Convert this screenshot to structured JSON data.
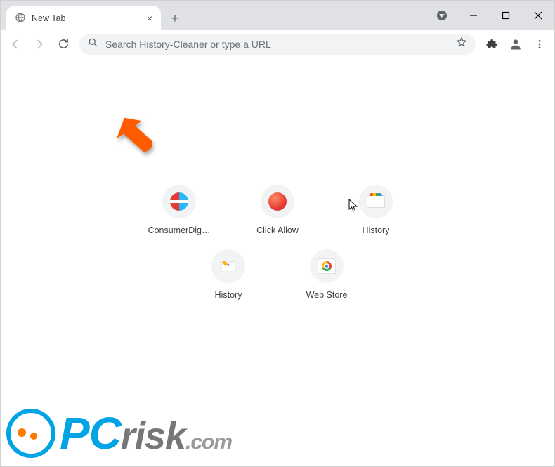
{
  "window": {
    "minimize_title": "Minimize",
    "maximize_title": "Maximize",
    "close_title": "Close"
  },
  "tabs": {
    "items": [
      {
        "title": "New Tab"
      }
    ],
    "newtab_title": "New tab"
  },
  "toolbar": {
    "back_title": "Back",
    "forward_title": "Forward",
    "reload_title": "Reload",
    "star_title": "Bookmark this tab",
    "extensions_title": "Extensions",
    "profile_title": "Profile",
    "menu_title": "Customize and control"
  },
  "omnibox": {
    "placeholder": "Search History-Cleaner or type a URL",
    "value": ""
  },
  "shortcuts": [
    {
      "label": "ConsumerDig…",
      "icon": "consumer"
    },
    {
      "label": "Click Allow",
      "icon": "click"
    },
    {
      "label": "History",
      "icon": "history1"
    },
    {
      "label": "History",
      "icon": "history2"
    },
    {
      "label": "Web Store",
      "icon": "webstore"
    }
  ],
  "watermark": {
    "text_prefix": "P",
    "text_prefix2": "C",
    "text_main": "risk",
    "text_suffix": ".com"
  }
}
